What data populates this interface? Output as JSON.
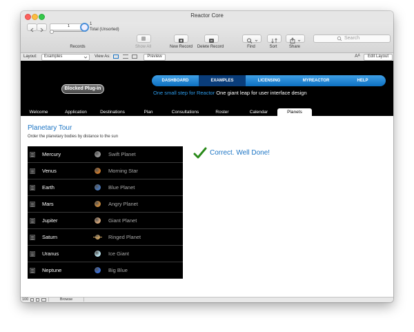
{
  "window": {
    "title": "Reactor Core"
  },
  "toolbar": {
    "records_input": "1",
    "records_count": "1",
    "records_status": "Total (Unsorted)",
    "records_label": "Records",
    "show_all": "Show All",
    "new_record": "New Record",
    "delete_record": "Delete Record",
    "find": "Find",
    "sort": "Sort",
    "share": "Share",
    "search_placeholder": "Search"
  },
  "layoutbar": {
    "layout_label": "Layout:",
    "layout_value": "Examples",
    "view_as": "View As:",
    "preview": "Preview",
    "font_icon": "Aᴬ",
    "edit_layout": "Edit Layout"
  },
  "header": {
    "nav": [
      "DASHBOARD",
      "EXAMPLES",
      "LICENSING",
      "MYREACTOR",
      "HELP"
    ],
    "active_nav": "EXAMPLES",
    "blocked_plugin": "Blocked Plug-in",
    "tagline_highlight": "One small step for Reactor",
    "tagline_rest": "One giant leap for user interface design"
  },
  "tabs": [
    "Welcome",
    "Application",
    "Destinations",
    "Plan",
    "Consultations",
    "Roster",
    "Calendar",
    "Planets"
  ],
  "active_tab": "Planets",
  "page": {
    "title": "Planetary Tour",
    "subtitle": "Order the planetary bodies by distance to the sun",
    "result": "Correct. Well Done!"
  },
  "planets": [
    {
      "name": "Mercury",
      "desc": "Swift Planet",
      "color": "#9a9a9a"
    },
    {
      "name": "Venus",
      "desc": "Morning Star",
      "color": "#c9782b"
    },
    {
      "name": "Earth",
      "desc": "Blue Planet",
      "color": "#4a78b8"
    },
    {
      "name": "Mars",
      "desc": "Angry Planet",
      "color": "#c98a3e"
    },
    {
      "name": "Jupiter",
      "desc": "Giant Planet",
      "color": "#d6a77a"
    },
    {
      "name": "Saturn",
      "desc": "Ringed Planet",
      "color": "#c9a060"
    },
    {
      "name": "Uranus",
      "desc": "Ice Giant",
      "color": "#bfe6f2"
    },
    {
      "name": "Neptune",
      "desc": "Big Blue",
      "color": "#3a6fd8"
    }
  ],
  "statusbar": {
    "zoom": "100",
    "mode": "Browse"
  },
  "colors": {
    "accent": "#1b74c4",
    "check": "#2a8a1a"
  }
}
